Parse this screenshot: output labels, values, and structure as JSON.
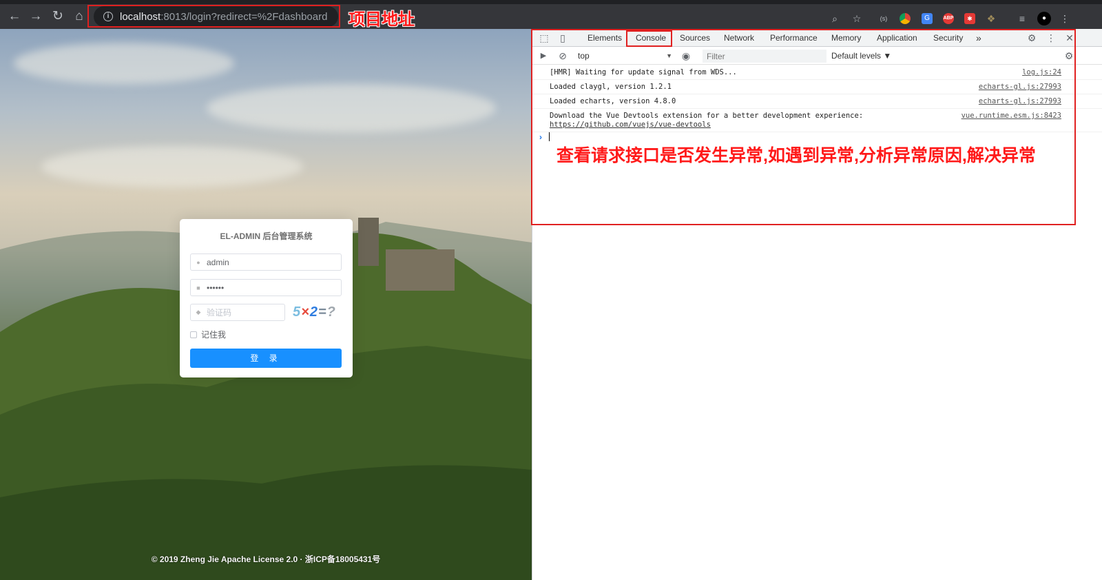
{
  "browser": {
    "url_host": "localhost",
    "url_path": ":8013/login?redirect=%2Fdashboard",
    "nav": {
      "back": "←",
      "forward": "→",
      "reload": "↻",
      "home": "⌂"
    },
    "toolbar_icons": [
      "zoom-icon",
      "star-icon",
      "extension-icon",
      "chrome-icon",
      "translate-icon",
      "adblock-icon",
      "puzzle-icon",
      "reading-list-icon",
      "profile-icon",
      "menu-icon"
    ]
  },
  "annotations": {
    "url_label": "项目地址",
    "console_label": "查看请求接口是否发生异常,如遇到异常,分析异常原因,解决异常",
    "color": "#e02020"
  },
  "login": {
    "title": "EL-ADMIN 后台管理系统",
    "username": "admin",
    "password": "••••••",
    "code_placeholder": "验证码",
    "captcha": {
      "c1": "5",
      "c2": "×",
      "c3": "2",
      "c4": "=",
      "c5": "?"
    },
    "remember_label": "记住我",
    "submit_label": "登 录",
    "accent": "#1890ff"
  },
  "footer": "© 2019 Zheng Jie Apache License 2.0 · 浙ICP备18005431号",
  "devtools": {
    "tabs": [
      "Elements",
      "Console",
      "Sources",
      "Network",
      "Performance",
      "Memory",
      "Application",
      "Security"
    ],
    "more": "»",
    "active_tab": "Console",
    "context": "top",
    "filter_placeholder": "Filter",
    "levels": "Default levels ▼",
    "messages": [
      {
        "text": "[HMR] Waiting for update signal from WDS...",
        "source": "log.js:24"
      },
      {
        "text": "Loaded claygl, version 1.2.1",
        "source": "echarts-gl.js:27993"
      },
      {
        "text": "Loaded echarts, version 4.8.0",
        "source": "echarts-gl.js:27993"
      },
      {
        "text": "Download the Vue Devtools extension for a better development experience:",
        "link": "https://github.com/vuejs/vue-devtools",
        "source": "vue.runtime.esm.js:8423"
      }
    ],
    "prompt": "›"
  }
}
